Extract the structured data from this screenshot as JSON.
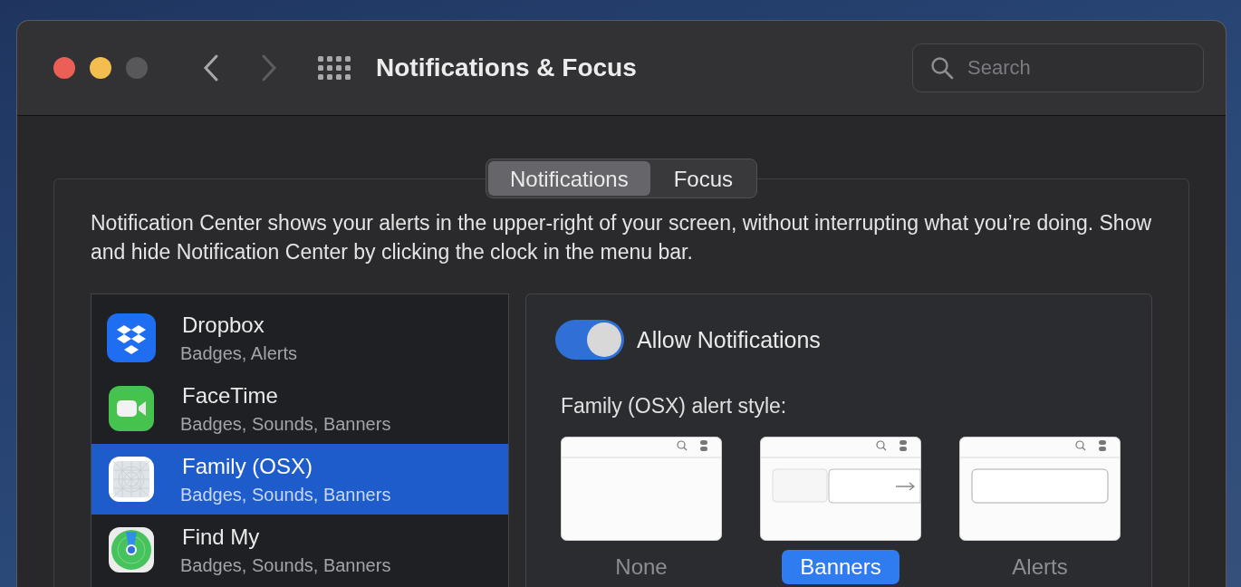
{
  "window": {
    "title": "Notifications & Focus"
  },
  "search": {
    "placeholder": "Search"
  },
  "tabs": [
    {
      "label": "Notifications",
      "selected": true
    },
    {
      "label": "Focus",
      "selected": false
    }
  ],
  "description": "Notification Center shows your alerts in the upper-right of your screen, without interrupting what you’re doing. Show and hide Notification Center by clicking the clock in the menu bar.",
  "apps": [
    {
      "name": "Dropbox",
      "detail": "Badges, Alerts",
      "selected": false
    },
    {
      "name": "FaceTime",
      "detail": "Badges, Sounds, Banners",
      "selected": false
    },
    {
      "name": "Family (OSX)",
      "detail": "Badges, Sounds, Banners",
      "selected": true
    },
    {
      "name": "Find My",
      "detail": "Badges, Sounds, Banners",
      "selected": false
    }
  ],
  "allow_notifications": {
    "label": "Allow Notifications",
    "on": true
  },
  "alert_style": {
    "label": "Family (OSX) alert style:",
    "options": [
      {
        "kind": "none",
        "label": "None",
        "selected": false
      },
      {
        "kind": "banners",
        "label": "Banners",
        "selected": true
      },
      {
        "kind": "alerts",
        "label": "Alerts",
        "selected": false
      }
    ]
  }
}
